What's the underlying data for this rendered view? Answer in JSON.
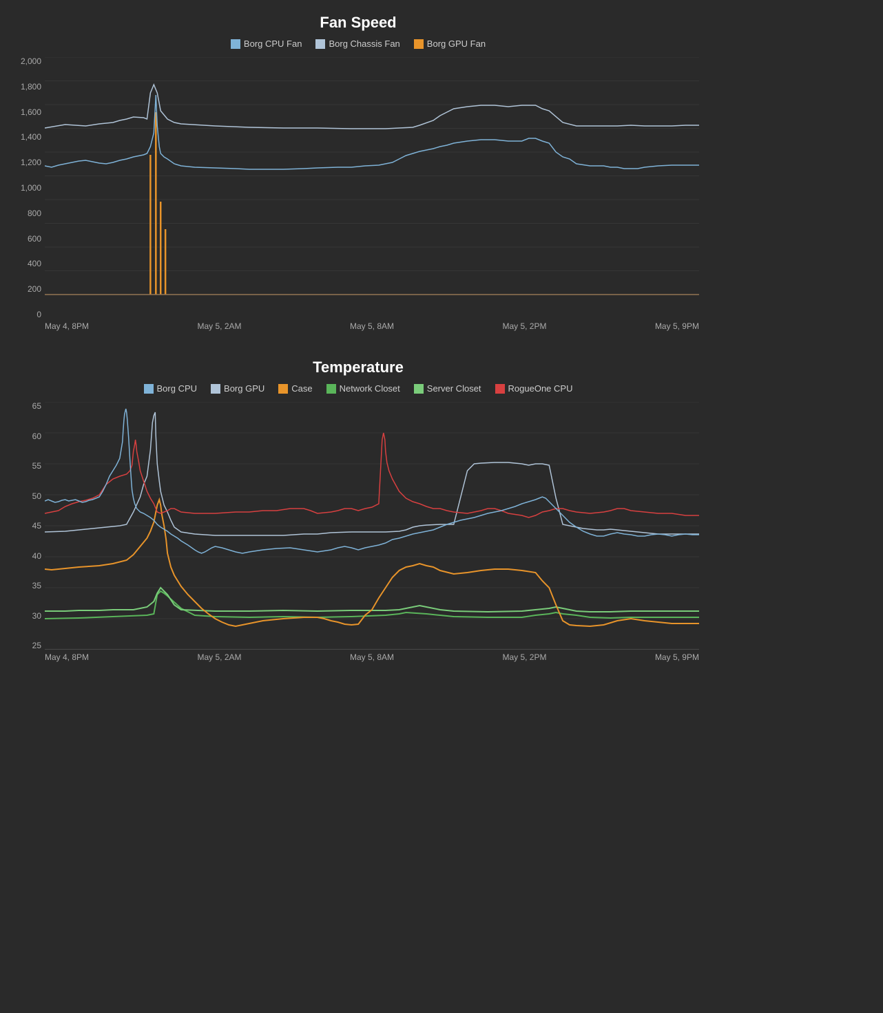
{
  "fan_speed": {
    "title": "Fan Speed",
    "legend": [
      {
        "label": "Borg CPU Fan",
        "color": "#7fb3d8"
      },
      {
        "label": "Borg Chassis Fan",
        "color": "#b0c4d8"
      },
      {
        "label": "Borg GPU Fan",
        "color": "#e8942a"
      }
    ],
    "y_labels": [
      "2,000",
      "1,800",
      "1,600",
      "1,400",
      "1,200",
      "1,000",
      "800",
      "600",
      "400",
      "200",
      "0"
    ],
    "x_labels": [
      "May 4, 8PM",
      "May 5, 2AM",
      "May 5, 8AM",
      "May 5, 2PM",
      "May 5, 9PM"
    ]
  },
  "temperature": {
    "title": "Temperature",
    "legend": [
      {
        "label": "Borg CPU",
        "color": "#7fb3d8"
      },
      {
        "label": "Borg GPU",
        "color": "#b0c4d8"
      },
      {
        "label": "Case",
        "color": "#e8942a"
      },
      {
        "label": "Network Closet",
        "color": "#5ab55a"
      },
      {
        "label": "Server Closet",
        "color": "#7acc7a"
      },
      {
        "label": "RogueOne CPU",
        "color": "#d84040"
      }
    ],
    "y_labels": [
      "65",
      "60",
      "55",
      "50",
      "45",
      "40",
      "35",
      "30",
      "25"
    ],
    "x_labels": [
      "May 4, 8PM",
      "May 5, 2AM",
      "May 5, 8AM",
      "May 5, 2PM",
      "May 5, 9PM"
    ]
  }
}
